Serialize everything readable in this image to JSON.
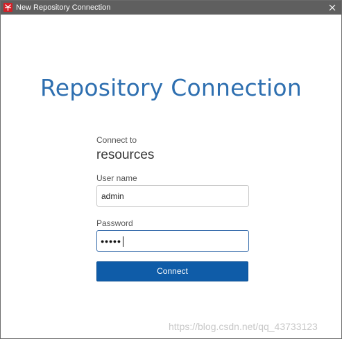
{
  "window": {
    "title": "New Repository Connection",
    "app_icon": "app-logo-icon",
    "close_icon": "close-icon"
  },
  "heading": "Repository Connection",
  "connect_to": {
    "label": "Connect to",
    "value": "resources"
  },
  "username": {
    "label": "User name",
    "value": "admin"
  },
  "password": {
    "label": "Password",
    "masked_value": "●●●●●"
  },
  "connect_button": {
    "label": "Connect"
  },
  "watermark": "https://blog.csdn.net/qq_43733123",
  "colors": {
    "titlebar": "#5f5f5f",
    "heading": "#2e6fb0",
    "button": "#0f5ca8",
    "focus_border": "#3b6fad"
  }
}
